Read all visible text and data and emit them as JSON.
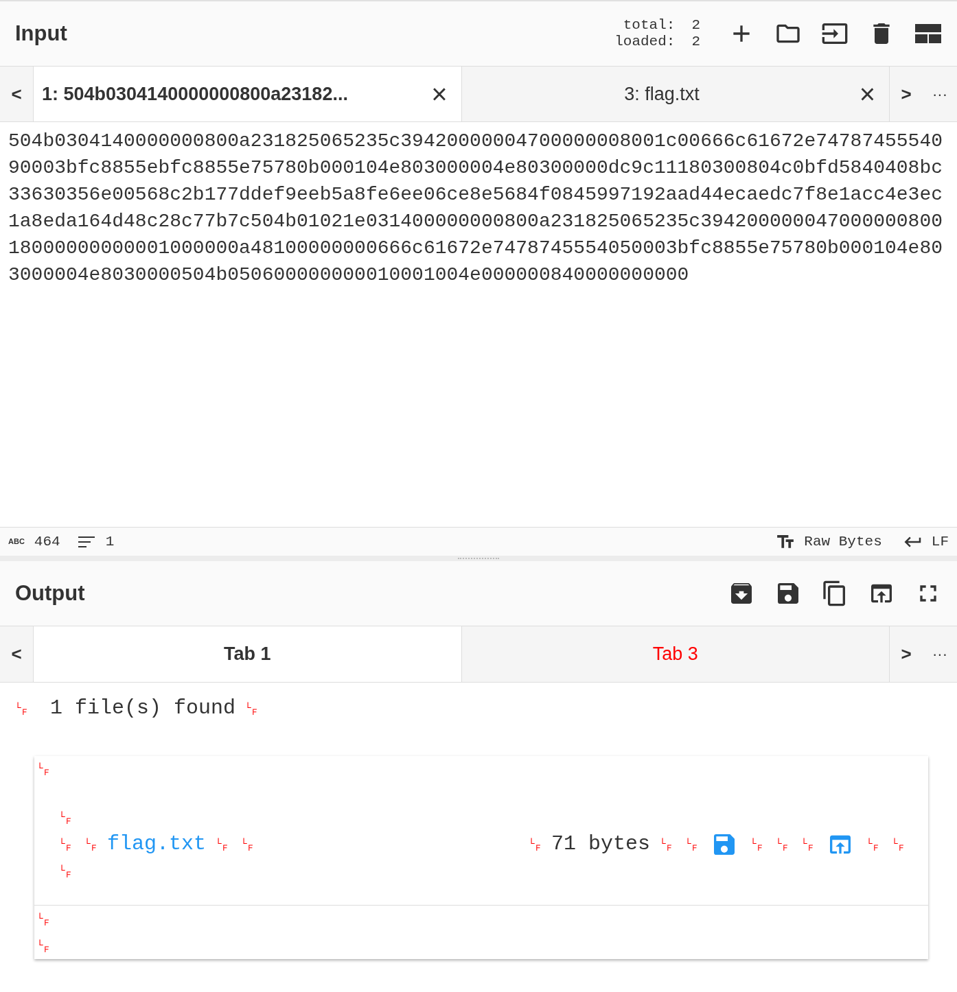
{
  "input": {
    "title": "Input",
    "counts": [
      {
        "label": "total:",
        "value": "2"
      },
      {
        "label": "loaded:",
        "value": "2"
      }
    ],
    "tabs_nav": {
      "prev": "<",
      "next": ">",
      "more": "···"
    },
    "tabs": [
      {
        "label": "1: 504b0304140000000800a23182...",
        "selected": true,
        "close": "×"
      },
      {
        "label": "3: flag.txt",
        "selected": false,
        "close": "×"
      }
    ],
    "text_lines": [
      "504b0304140000000800a231825065235c39420000004700000008001c00666c61672e74787455540",
      "90003bfc8855ebfc8855e75780b000104e803000004e80300000dc9c11180300804c0bfd5840408bc",
      "33630356e00568c2b177ddef9eeb5a8fe6ee06ce8e5684f0845997192aad44ecaedc7f8e1acc4e3ec",
      "1a8eda164d48c28c77b7c504b01021e031400000000800a231825065235c394200000047000000800",
      "18000000000001000000a48100000000666c61672e7478745554050003bfc8855e75780b000104e80",
      "3000004e8030000504b050600000000010001004e000000840000000000"
    ],
    "status": {
      "abc": "ABC",
      "length": "464",
      "lines": "1",
      "encoding": "Raw Bytes",
      "eol": "LF"
    }
  },
  "output": {
    "title": "Output",
    "tabs_nav": {
      "prev": "<",
      "next": ">",
      "more": "···"
    },
    "tabs": [
      {
        "label": "Tab 1",
        "selected": true,
        "highlighted": false
      },
      {
        "label": "Tab 3",
        "selected": false,
        "highlighted": true
      }
    ],
    "summary": [
      {
        "kind": "lf",
        "text": "␊"
      },
      {
        "kind": "text",
        "text": " 1 file(s) found"
      },
      {
        "kind": "lf",
        "text": "␊"
      }
    ],
    "card": {
      "top": [
        {
          "kind": "lf",
          "text": "␊"
        }
      ],
      "entry_before": [
        {
          "kind": "lf",
          "text": "␊"
        }
      ],
      "entry_name": [
        {
          "kind": "lf",
          "text": "␊"
        },
        {
          "kind": "lf",
          "text": "␊"
        },
        {
          "kind": "link",
          "text": "flag.txt"
        },
        {
          "kind": "lf",
          "text": "␊"
        },
        {
          "kind": "lf",
          "text": "␊"
        }
      ],
      "entry_after": [
        {
          "kind": "lf",
          "text": "␊"
        }
      ],
      "entry_details": [
        {
          "kind": "lf",
          "text": "␊"
        },
        {
          "kind": "text",
          "text": "71 bytes"
        },
        {
          "kind": "lf",
          "text": "␊"
        },
        {
          "kind": "lf",
          "text": "␊"
        },
        {
          "kind": "save_icon"
        },
        {
          "kind": "lf",
          "text": "␊"
        },
        {
          "kind": "lf",
          "text": "␊"
        },
        {
          "kind": "lf",
          "text": "␊"
        },
        {
          "kind": "open_icon"
        },
        {
          "kind": "lf",
          "text": "␊"
        },
        {
          "kind": "lf",
          "text": "␊"
        }
      ],
      "bottom": [
        [
          {
            "kind": "lf",
            "text": "␊"
          }
        ],
        [
          {
            "kind": "lf",
            "text": "␊"
          }
        ]
      ]
    }
  }
}
